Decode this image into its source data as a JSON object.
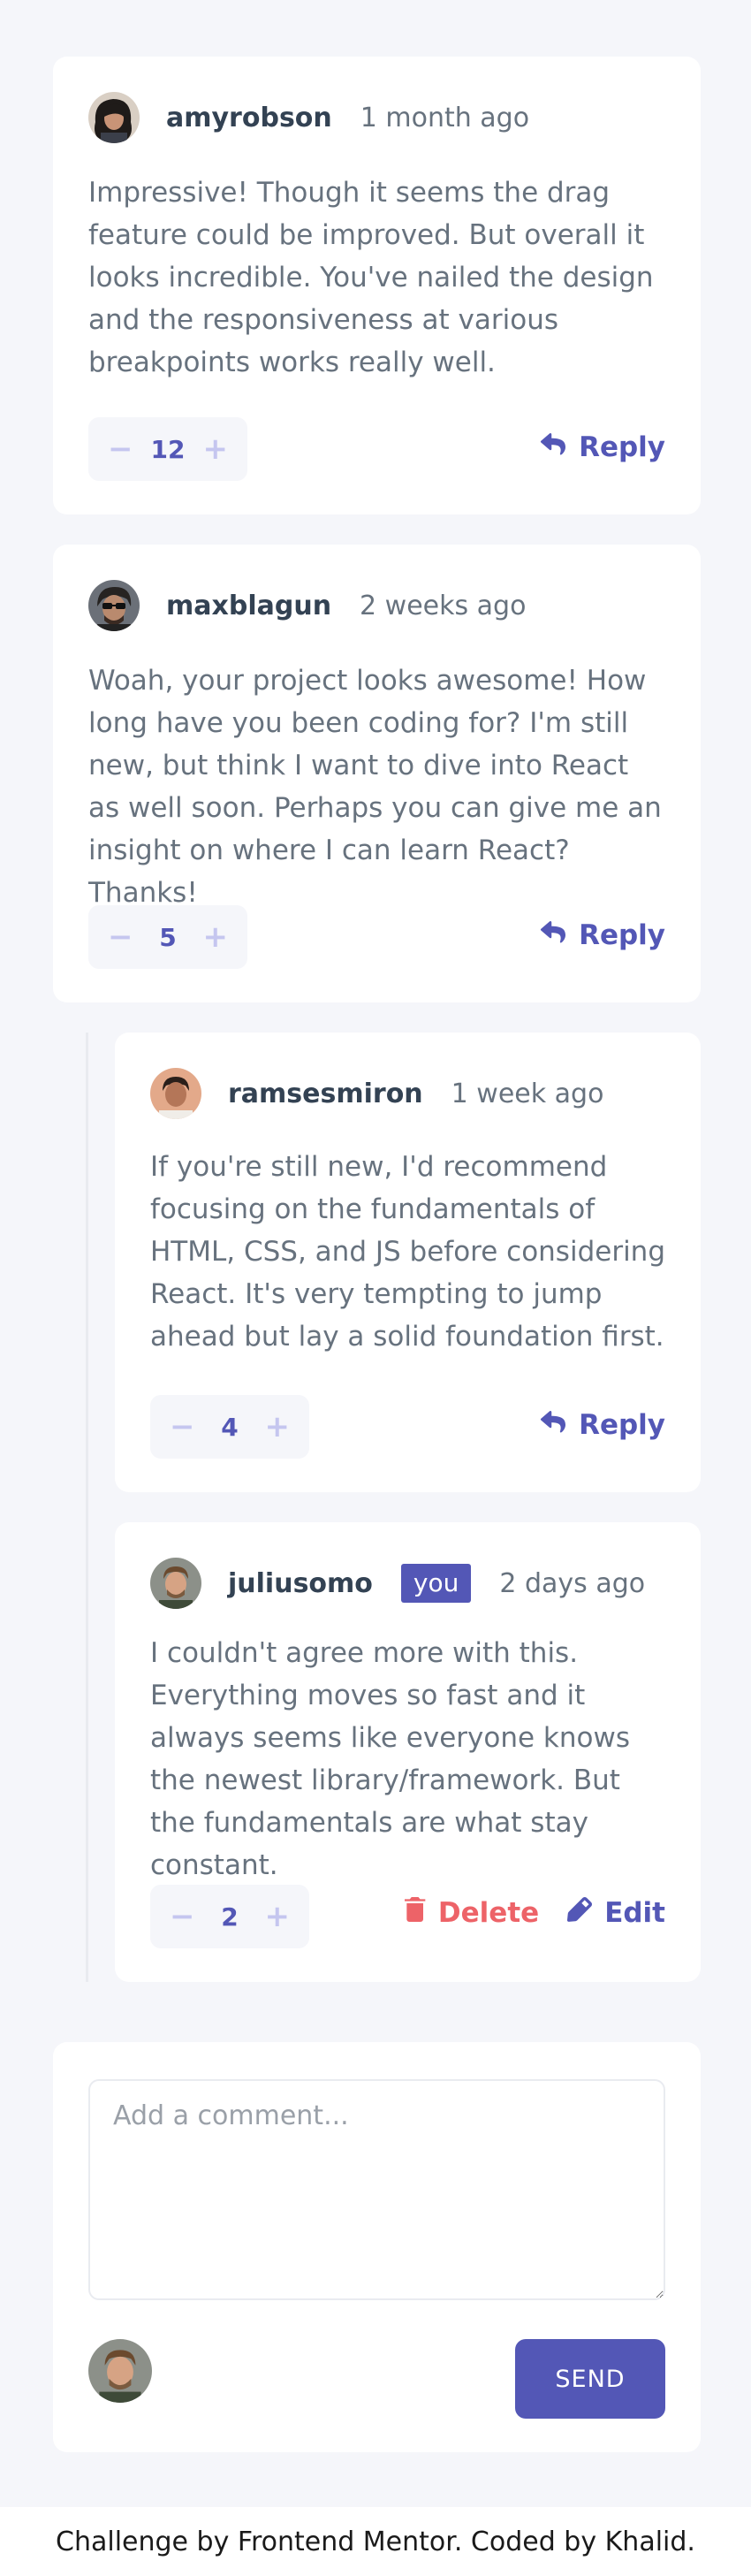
{
  "comments": [
    {
      "username": "amyrobson",
      "date": "1 month ago",
      "content": "Impressive! Though it seems the drag feature could be improved. But overall it looks incredible. You've nailed the design and the responsiveness at various breakpoints works really well.",
      "score": "12",
      "reply_label": "Reply",
      "avatar_icon": "avatar-amyrobson-icon"
    },
    {
      "username": "maxblagun",
      "date": "2 weeks ago",
      "content": "Woah, your project looks awesome! How long have you been coding for? I'm still new, but think I want to dive into React as well soon. Perhaps you can give me an insight on where I can learn React? Thanks!",
      "score": "5",
      "reply_label": "Reply",
      "avatar_icon": "avatar-maxblagun-icon"
    }
  ],
  "replies": [
    {
      "username": "ramsesmiron",
      "date": "1 week ago",
      "content": "If you're still new, I'd recommend focusing on the fundamentals of HTML, CSS, and JS before considering React. It's very tempting to jump ahead but lay a solid foundation first.",
      "score": "4",
      "reply_label": "Reply",
      "avatar_icon": "avatar-ramsesmiron-icon"
    },
    {
      "username": "juliusomo",
      "badge": "you",
      "date": "2 days ago",
      "content": "I couldn't agree more with this. Everything moves so fast and it always seems like everyone knows the newest library/framework. But the fundamentals are what stay constant.",
      "score": "2",
      "delete_label": "Delete",
      "edit_label": "Edit",
      "avatar_icon": "avatar-juliusomo-icon"
    }
  ],
  "counter_symbols": {
    "minus": "−",
    "plus": "+"
  },
  "new_comment": {
    "placeholder": "Add a comment...",
    "send_label": "SEND",
    "avatar_icon": "avatar-current-user-icon"
  },
  "footer": {
    "text": "Challenge by Frontend Mentor. Coded by Khalid."
  },
  "colors": {
    "primary": "#5357b6",
    "danger": "#ed6368",
    "light_primary": "#c5c6ef",
    "text": "#67727e",
    "heading": "#334253",
    "background": "#f5f6fa"
  }
}
